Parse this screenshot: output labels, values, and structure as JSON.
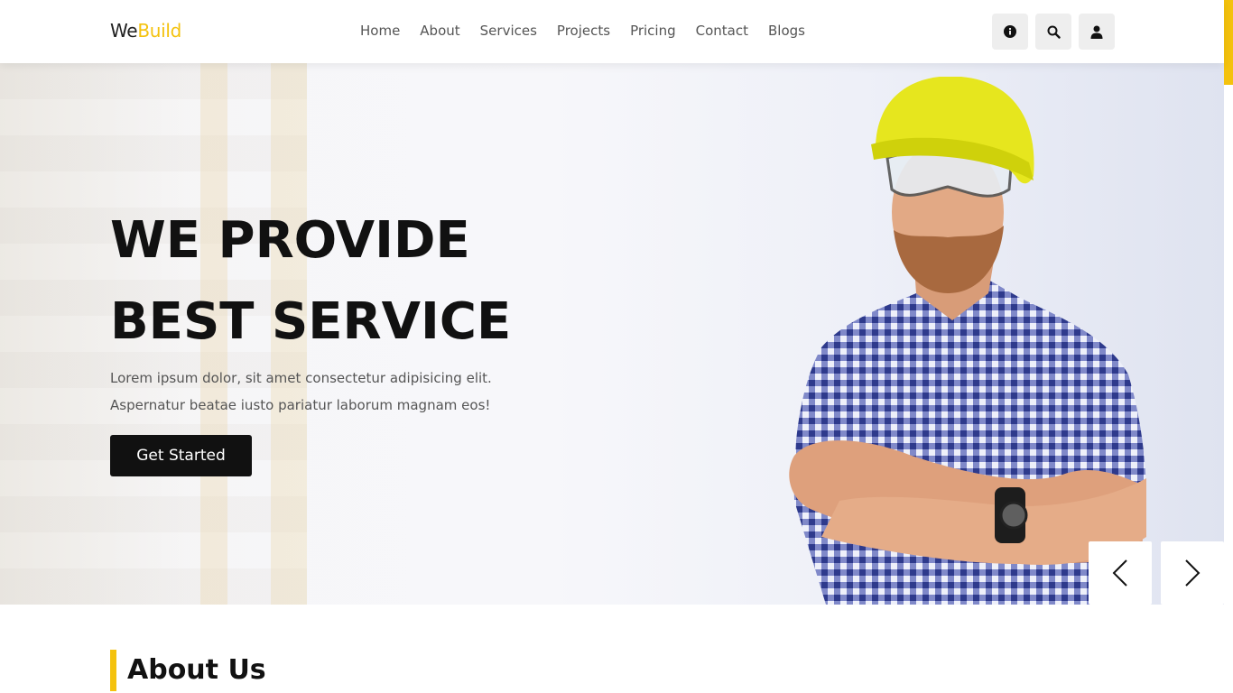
{
  "brand": {
    "logo_prefix": "We",
    "logo_accent": "Build",
    "accent_color": "#f4c20d"
  },
  "nav": {
    "items": [
      {
        "label": "Home"
      },
      {
        "label": "About"
      },
      {
        "label": "Services"
      },
      {
        "label": "Projects"
      },
      {
        "label": "Pricing"
      },
      {
        "label": "Contact"
      },
      {
        "label": "Blogs"
      }
    ]
  },
  "header_icons": [
    {
      "icon": "info-icon"
    },
    {
      "icon": "search-icon"
    },
    {
      "icon": "user-icon"
    }
  ],
  "hero": {
    "title_line1": "WE PROVIDE",
    "title_line2": "BEST SERVICE",
    "sub_line1": "Lorem ipsum dolor, sit amet consectetur adipisicing elit.",
    "sub_line2": "Aspernatur beatae iusto pariatur laborum magnam eos!",
    "cta_label": "Get Started"
  },
  "slider": {
    "prev_icon": "chevron-left-icon",
    "next_icon": "chevron-right-icon"
  },
  "about": {
    "heading": "About Us"
  }
}
